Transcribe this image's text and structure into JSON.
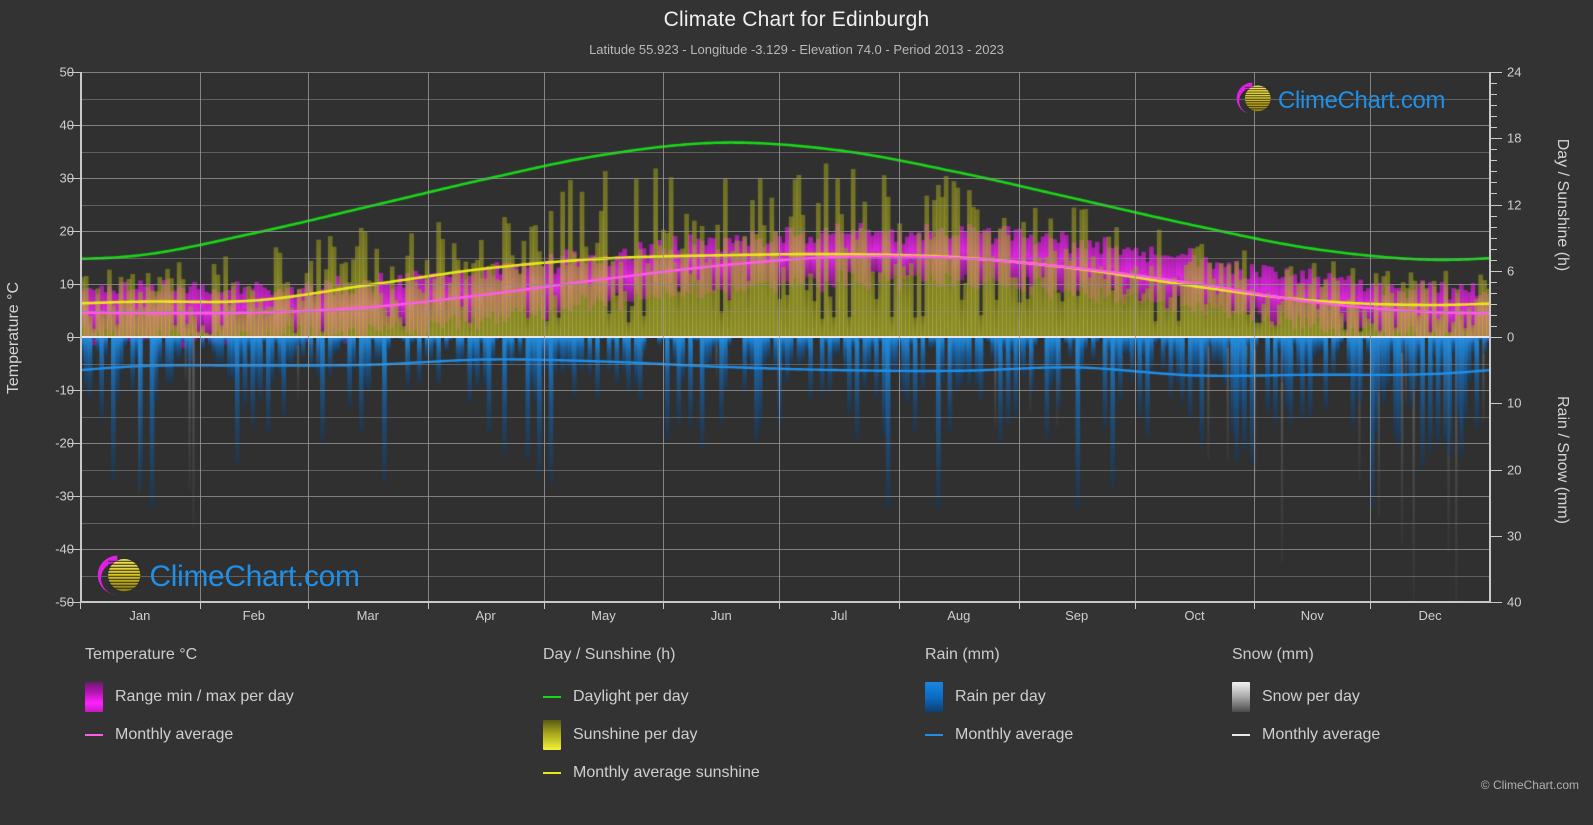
{
  "header": {
    "title": "Climate Chart for Edinburgh",
    "subtitle": "Latitude 55.923 - Longitude -3.129 - Elevation 74.0 - Period 2013 - 2023"
  },
  "axes": {
    "left_label": "Temperature °C",
    "right_top_label": "Day / Sunshine (h)",
    "right_bottom_label": "Rain / Snow (mm)",
    "left_ticks": [
      "50",
      "40",
      "30",
      "20",
      "10",
      "0",
      "-10",
      "-20",
      "-30",
      "-40",
      "-50"
    ],
    "right_ticks": [
      "24",
      "18",
      "12",
      "6",
      "0",
      "10",
      "20",
      "30",
      "40"
    ],
    "x_ticks": [
      "Jan",
      "Feb",
      "Mar",
      "Apr",
      "May",
      "Jun",
      "Jul",
      "Aug",
      "Sep",
      "Oct",
      "Nov",
      "Dec"
    ]
  },
  "legend": {
    "temperature": {
      "heading": "Temperature °C",
      "range_label": "Range min / max per day",
      "average_label": "Monthly average"
    },
    "sunshine": {
      "heading": "Day / Sunshine (h)",
      "daylight_label": "Daylight per day",
      "sunshine_label": "Sunshine per day",
      "average_label": "Monthly average sunshine"
    },
    "rain": {
      "heading": "Rain (mm)",
      "per_day_label": "Rain per day",
      "average_label": "Monthly average"
    },
    "snow": {
      "heading": "Snow (mm)",
      "per_day_label": "Snow per day",
      "average_label": "Monthly average"
    }
  },
  "watermark": {
    "text": "ClimeChart.com"
  },
  "footer": {
    "copyright": "© ClimeChart.com"
  },
  "colors": {
    "background": "#333333",
    "plot_background": "#303030",
    "grid": "#8d8d8d",
    "axis": "#c9c9c9",
    "daylight": "#18d818",
    "sunshine": "#e8e818",
    "sunshine_fill": "#a8a81e",
    "temperature_line": "#ff5ce6",
    "temperature_fill": "#d11ad1",
    "rain": "#1f8fe8",
    "rain_line": "#1f8fe8",
    "snow": "#bdbdbd",
    "logo_blue": "#1f8fe8",
    "logo_magenta": "#e020e0",
    "logo_yellow": "#e0d020"
  },
  "chart_data": {
    "type": "line",
    "title": "Climate Chart for Edinburgh",
    "subtitle": "Latitude 55.923 - Longitude -3.129 - Elevation 74.0 - Period 2013 - 2023",
    "xlabel": "",
    "ylabel": "Temperature °C",
    "y2label_top": "Day / Sunshine (h)",
    "y2label_bottom": "Rain / Snow (mm)",
    "ylim": [
      -50,
      50
    ],
    "y2lim_sunshine": [
      0,
      24
    ],
    "y2lim_precip": [
      0,
      40
    ],
    "grid": true,
    "legend_position": "below",
    "categories": [
      "Jan",
      "Feb",
      "Mar",
      "Apr",
      "May",
      "Jun",
      "Jul",
      "Aug",
      "Sep",
      "Oct",
      "Nov",
      "Dec"
    ],
    "series": [
      {
        "name": "Daylight per day",
        "unit": "h",
        "axis": "right_top",
        "color": "#18d818",
        "values": [
          7.4,
          9.4,
          11.8,
          14.3,
          16.5,
          17.6,
          16.9,
          14.9,
          12.5,
          10.1,
          8.0,
          7.0
        ]
      },
      {
        "name": "Monthly average sunshine",
        "unit": "h",
        "axis": "right_top",
        "color": "#e8e818",
        "values": [
          3.2,
          3.3,
          4.7,
          6.2,
          7.1,
          7.4,
          7.5,
          7.2,
          6.2,
          4.6,
          3.3,
          2.9
        ]
      },
      {
        "name": "Monthly average temperature",
        "unit": "°C",
        "axis": "left",
        "color": "#ff5ce6",
        "values": [
          4.5,
          4.6,
          5.6,
          8.0,
          10.9,
          13.5,
          15.1,
          14.9,
          13.0,
          10.1,
          6.6,
          4.7
        ]
      },
      {
        "name": "Monthly average rain",
        "unit": "mm",
        "axis": "right_bottom",
        "color": "#1f8fe8",
        "values": [
          4.4,
          4.3,
          4.2,
          3.4,
          3.7,
          4.5,
          5.0,
          5.1,
          4.6,
          5.8,
          5.7,
          5.6
        ]
      }
    ],
    "daily_bands": [
      {
        "name": "Range min / max per day",
        "color": "#d11ad1",
        "axis": "left"
      },
      {
        "name": "Sunshine per day",
        "color": "#a8a81e",
        "axis": "right_top"
      },
      {
        "name": "Rain per day",
        "color": "#1f8fe8",
        "axis": "right_bottom"
      },
      {
        "name": "Snow per day",
        "color": "#bdbdbd",
        "axis": "right_bottom"
      }
    ],
    "annotations": [
      "ClimeChart.com watermark top-right",
      "ClimeChart.com watermark bottom-left"
    ]
  }
}
